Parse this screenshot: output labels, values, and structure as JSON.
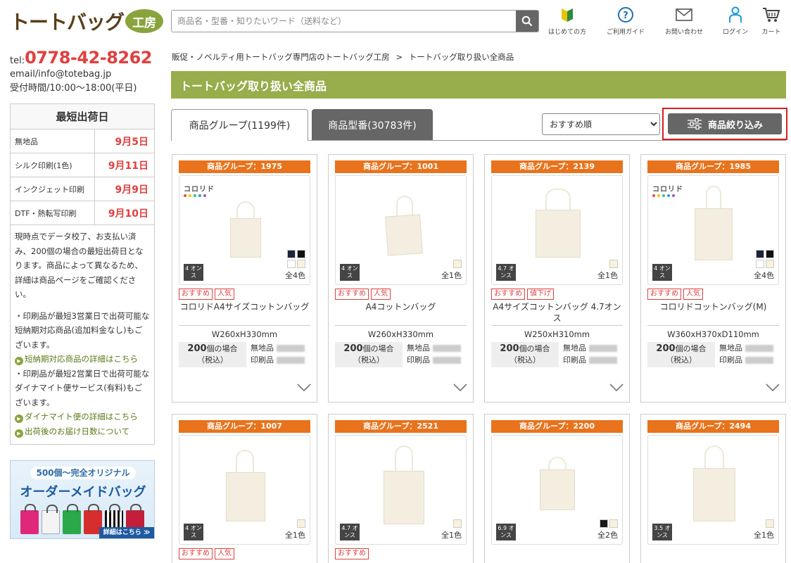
{
  "header": {
    "logo_text": "トートバッグ",
    "logo_badge": "工房",
    "search_placeholder": "商品名・型番・知りたいワード（送料など）",
    "nav": [
      {
        "label": "はじめての方",
        "icon": "beginner-mark-icon"
      },
      {
        "label": "ご利用ガイド",
        "icon": "question-icon"
      },
      {
        "label": "お問い合わせ",
        "icon": "mail-icon"
      },
      {
        "label": "ログイン",
        "icon": "user-icon"
      },
      {
        "label": "カート",
        "icon": "cart-icon"
      }
    ]
  },
  "contact": {
    "tel_label": "tel:",
    "tel": "0778-42-8262",
    "email_label": "email/",
    "email": "info@totebag.jp",
    "hours": "受付時間/10:00～18:00(平日)"
  },
  "shipping": {
    "title": "最短出荷日",
    "rows": [
      {
        "label": "無地品",
        "date": "9月5日"
      },
      {
        "label": "シルク印刷(1色)",
        "date": "9月11日"
      },
      {
        "label": "インクジェット印刷",
        "date": "9月9日"
      },
      {
        "label": "DTF・熱転写印刷",
        "date": "9月10日"
      }
    ],
    "note1": "現時点でデータ校了、お支払い済み、200個の場合の最短出荷日となります。商品によって異なるため、詳細は商品ページをご確認ください。",
    "note2": "・印刷品が最短3営業日で出荷可能な短納期対応商品(追加料金なし)もございます。",
    "link1": "短納期対応商品の詳細はこちら",
    "note3": "・印刷品が最短2営業日で出荷可能なダイナマイト便サービス(有料)もございます。",
    "link2": "ダイナマイト便の詳細はこちら",
    "link3": "出荷後のお届け日数について"
  },
  "banner": {
    "line1": "500個～完全オリジナル",
    "line2": "オーダーメイドバッグ",
    "more": "詳細はこちら ≫"
  },
  "breadcrumb": {
    "home": "販促・ノベルティ用トートバッグ専門店のトートバッグ工房",
    "sep": ">",
    "current": "トートバッグ取り扱い全商品"
  },
  "page_title": "トートバッグ取り扱い全商品",
  "tabs": [
    {
      "label": "商品グループ(1199件)",
      "active": true
    },
    {
      "label": "商品型番(30783件)",
      "active": false
    }
  ],
  "sort": {
    "selected": "おすすめ順"
  },
  "filter_label": "商品絞り込み",
  "price_labels": {
    "qty": "200",
    "qty_suffix": "個の場合",
    "tax": "（税込）",
    "plain": "無地品",
    "printed": "印刷品"
  },
  "products": [
    {
      "group": "商品グループ：1975",
      "oz": "4 オンス",
      "colors": "全4色",
      "tags": [
        "おすすめ",
        "人気"
      ],
      "name": "コロリドA4サイズコットンバッグ",
      "size": "W260xH330mm",
      "brand": "コロリド"
    },
    {
      "group": "商品グループ：1001",
      "oz": "4 オンス",
      "colors": "全1色",
      "tags": [
        "おすすめ",
        "人気"
      ],
      "name": "A4コットンバッグ",
      "size": "W260xH330mm"
    },
    {
      "group": "商品グループ：2139",
      "oz": "4.7 オンス",
      "colors": "全1色",
      "tags": [
        "おすすめ",
        "値下げ"
      ],
      "name": "A4サイズコットンバッグ 4.7オンス",
      "size": "W250xH310mm"
    },
    {
      "group": "商品グループ：1985",
      "oz": "4 オンス",
      "colors": "全4色",
      "tags": [
        "おすすめ",
        "人気"
      ],
      "name": "コロリドコットンバッグ(M)",
      "size": "W360xH370xD110mm",
      "brand": "コロリド"
    },
    {
      "group": "商品グループ：1007",
      "oz": "4 オンス",
      "colors": "全1色",
      "tags": [
        "おすすめ",
        "人気"
      ]
    },
    {
      "group": "商品グループ：2521",
      "oz": "4.7 オンス",
      "colors": "全1色",
      "tags": [
        "おすすめ"
      ]
    },
    {
      "group": "商品グループ：2200",
      "oz": "6.9 オンス",
      "colors": "全2色",
      "tags": []
    },
    {
      "group": "商品グループ：2494",
      "oz": "3.5 オンス",
      "colors": "全1色",
      "tags": []
    }
  ]
}
